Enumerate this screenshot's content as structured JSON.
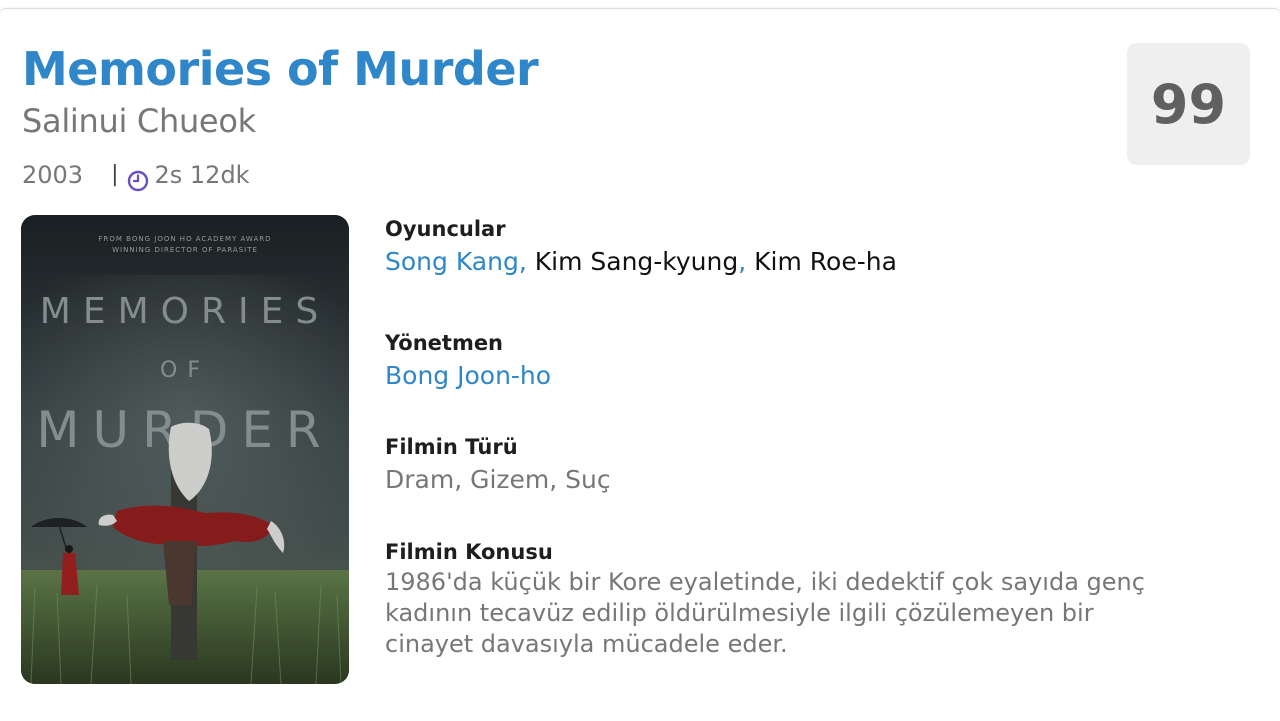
{
  "movie": {
    "title": "Memories of Murder",
    "original_title": "Salinui Chueok",
    "year": "2003",
    "separator": "|",
    "duration": "2s 12dk",
    "score": "99"
  },
  "poster": {
    "tagline_line1": "FROM BONG JOON HO ACADEMY AWARD",
    "tagline_line2": "WINNING DIRECTOR OF PARASITE",
    "title_line1": "MEMORIES",
    "title_line2": "OF",
    "title_line3": "MURDER"
  },
  "details": {
    "cast_label": "Oyuncular",
    "cast": [
      {
        "name": "Song Kang",
        "sep": ","
      },
      {
        "name": "Kim Sang-kyung",
        "sep": ","
      },
      {
        "name": "Kim Roe-ha",
        "sep": ""
      }
    ],
    "director_label": "Yönetmen",
    "director": "Bong Joon-ho",
    "genre_label": "Filmin Türü",
    "genres": "Dram, Gizem, Suç",
    "plot_label": "Filmin Konusu",
    "plot_line1": "1986'da küçük bir Kore eyaletinde, iki dedektif çok sayıda genç",
    "plot_line2": "kadının tecavüz edilip öldürülmesiyle ilgili çözülemeyen bir",
    "plot_line3": "cinayet davasıyla mücadele eder."
  },
  "icons": {
    "duration": "clock-icon"
  },
  "colors": {
    "accent": "#2f86c9",
    "text_dark": "#1e1e1e",
    "text_muted": "#777777",
    "clock": "#6a4fbf",
    "score_bg": "#efefef",
    "score_text": "#606060"
  }
}
